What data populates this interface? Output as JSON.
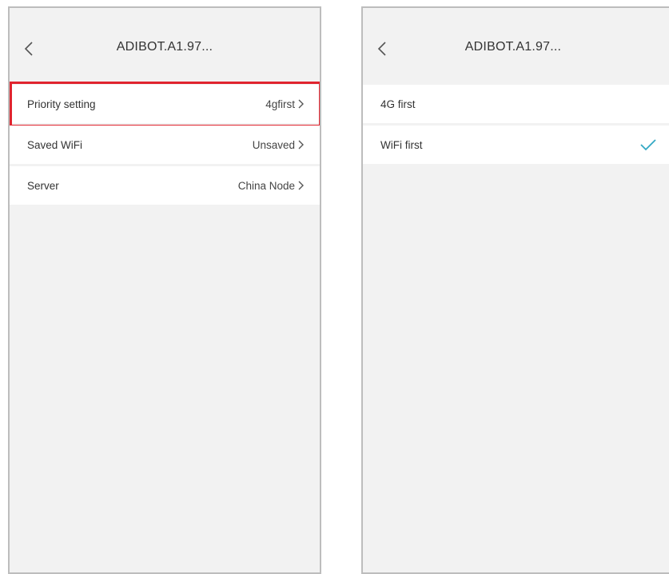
{
  "left_screen": {
    "title": "ADIBOT.A1.97...",
    "rows": [
      {
        "label": "Priority setting",
        "value": "4gfirst"
      },
      {
        "label": "Saved WiFi",
        "value": "Unsaved"
      },
      {
        "label": "Server",
        "value": "China Node"
      }
    ],
    "highlight_color": "#e0242e"
  },
  "right_screen": {
    "title": "ADIBOT.A1.97...",
    "options": [
      {
        "label": "4G first",
        "selected": false
      },
      {
        "label": "WiFi first",
        "selected": true
      }
    ],
    "check_color": "#33a8c4"
  },
  "icons": {
    "back": "chevron-left-icon",
    "row_arrow": "chevron-right-icon",
    "selected": "checkmark-icon"
  }
}
